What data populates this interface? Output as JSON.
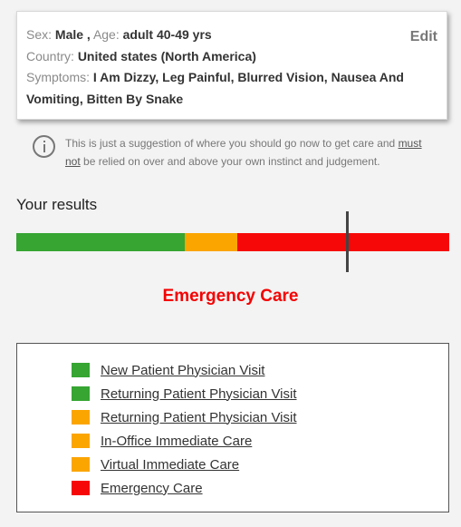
{
  "profile": {
    "sex_label": "Sex:",
    "sex_value": "Male ,",
    "age_label": "Age:",
    "age_value": "adult 40-49 yrs",
    "country_label": "Country:",
    "country_value": "United states (North America)",
    "symptoms_label": "Symptoms:",
    "symptoms_value": "I Am Dizzy, Leg Painful, Blurred Vision, Nausea And Vomiting, Bitten By Snake",
    "edit_label": "Edit"
  },
  "disclaimer": {
    "icon": "info-icon",
    "text_before": "This is just a suggestion of where you should go now to get care and",
    "text_emph": "must not",
    "text_after": "be relied on over and above your own instinct and judgement."
  },
  "results": {
    "title": "Your results",
    "level_label": "Emergency Care",
    "marker_fraction": 0.765
  },
  "colors": {
    "green": "#36a532",
    "orange": "#fba500",
    "red": "#f70808"
  },
  "legend": [
    {
      "label": "New Patient Physician Visit",
      "color": "#36a532"
    },
    {
      "label": "Returning Patient Physician Visit",
      "color": "#36a532"
    },
    {
      "label": "Returning Patient Physician Visit",
      "color": "#fba500"
    },
    {
      "label": "In-Office Immediate Care",
      "color": "#fba500"
    },
    {
      "label": "Virtual Immediate Care",
      "color": "#fba500"
    },
    {
      "label": "Emergency Care",
      "color": "#f70808"
    }
  ]
}
